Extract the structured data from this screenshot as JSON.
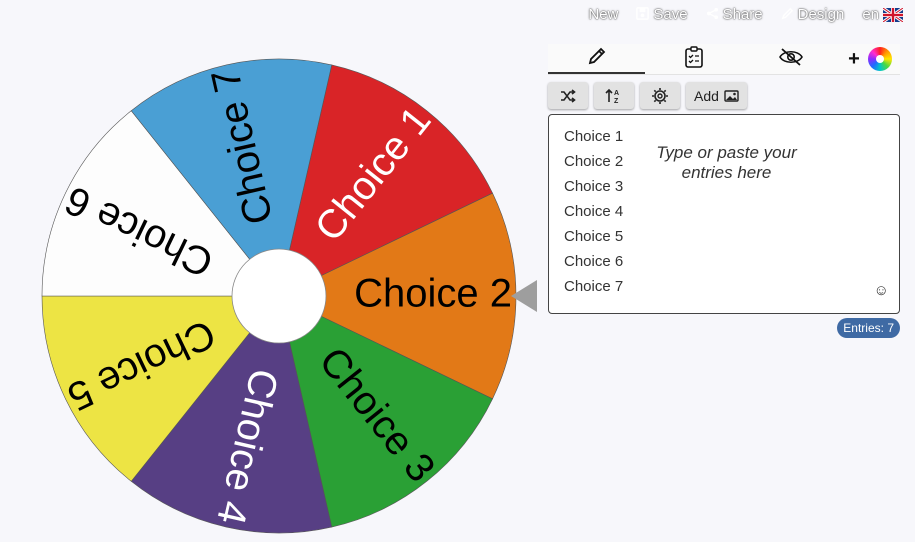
{
  "topbar": {
    "new_label": "New",
    "save_label": "Save",
    "share_label": "Share",
    "design_label": "Design",
    "lang_label": "en"
  },
  "wheel": {
    "slices": [
      {
        "label": "Choice 1",
        "color": "#d92427",
        "text_color": "#ffffff"
      },
      {
        "label": "Choice 2",
        "color": "#e27917",
        "text_color": "#000000"
      },
      {
        "label": "Choice 3",
        "color": "#2aa035",
        "text_color": "#000000"
      },
      {
        "label": "Choice 4",
        "color": "#573f84",
        "text_color": "#ffffff"
      },
      {
        "label": "Choice 5",
        "color": "#ede444",
        "text_color": "#000000"
      },
      {
        "label": "Choice 6",
        "color": "#fdfdfd",
        "text_color": "#000000"
      },
      {
        "label": "Choice 7",
        "color": "#4a9fd4",
        "text_color": "#000000"
      }
    ]
  },
  "panel": {
    "tabs": [
      "edit-icon",
      "results-icon",
      "hide-icon"
    ],
    "toolbar": {
      "add_label": "Add"
    },
    "entries": [
      "Choice 1",
      "Choice 2",
      "Choice 3",
      "Choice 4",
      "Choice 5",
      "Choice 6",
      "Choice 7"
    ],
    "placeholder": "Type or paste your entries here",
    "count_label": "Entries: 7"
  }
}
